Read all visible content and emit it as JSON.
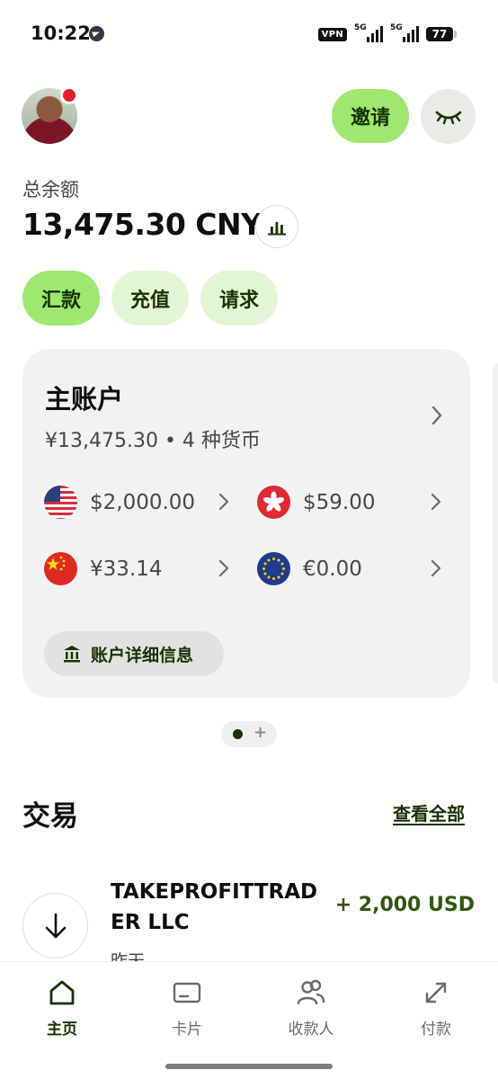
{
  "status_bar": {
    "time": "10:22",
    "vpn": "VPN",
    "signal_1": "5G",
    "signal_2": "5G",
    "battery": "77"
  },
  "header": {
    "invite_label": "邀请",
    "eye_icon": "eye-closed-icon"
  },
  "balance": {
    "label": "总余额",
    "value": "13,475.30 CNY",
    "chart_icon": "bar-chart-icon"
  },
  "actions": {
    "send": "汇款",
    "add": "充值",
    "request": "请求"
  },
  "account": {
    "title": "主账户",
    "subtitle": "¥13,475.30 • 4 种货币",
    "currencies": [
      {
        "flag": "us-flag",
        "amount": "$2,000.00"
      },
      {
        "flag": "hk-flag",
        "amount": "$59.00"
      },
      {
        "flag": "cn-flag",
        "amount": "¥33.14"
      },
      {
        "flag": "eu-flag",
        "amount": "€0.00"
      }
    ],
    "details_label": "账户详细信息"
  },
  "pager": {
    "pages": 2,
    "active_index": 0
  },
  "transactions": {
    "title": "交易",
    "see_all": "查看全部",
    "items": [
      {
        "name": "TAKEPROFITTRADER LLC",
        "date": "昨天",
        "amount": "+ 2,000 USD",
        "icon": "arrow-down-icon"
      }
    ]
  },
  "nav": {
    "items": [
      {
        "label": "主页",
        "icon": "home-icon",
        "active": true
      },
      {
        "label": "卡片",
        "icon": "card-icon",
        "active": false
      },
      {
        "label": "收款人",
        "icon": "recipients-icon",
        "active": false
      },
      {
        "label": "付款",
        "icon": "payments-icon",
        "active": false
      }
    ]
  },
  "colors": {
    "brand_green": "#9fe870",
    "brand_green_light": "#e2f6d5",
    "forest": "#163300",
    "card_bg": "#f2f2f2",
    "positive_amount": "#2f5711"
  }
}
